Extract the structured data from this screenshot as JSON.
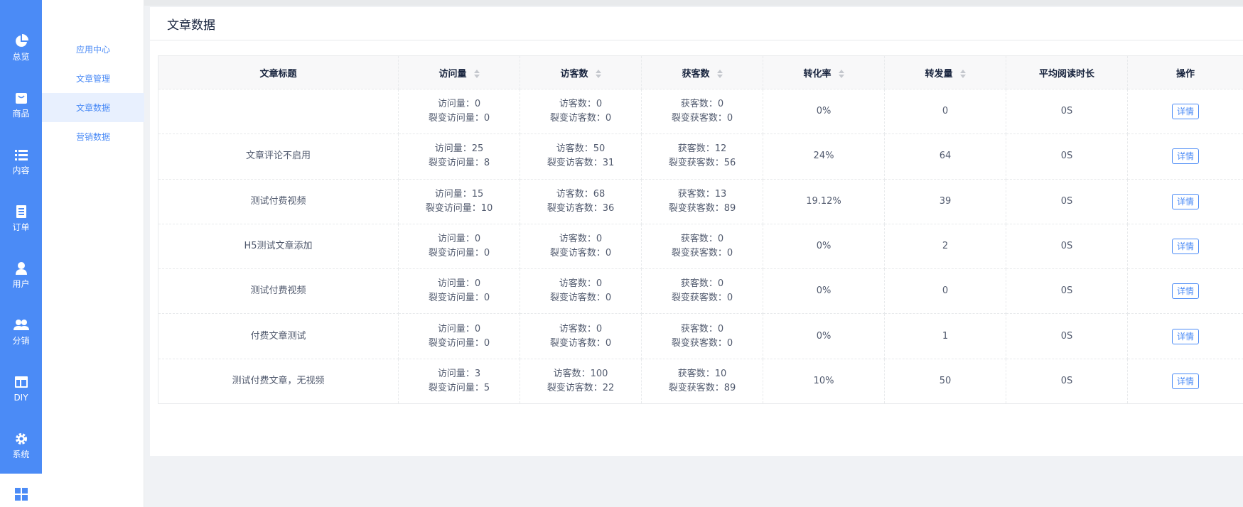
{
  "rail": {
    "items": [
      {
        "label": "总览",
        "icon": "pie-chart-icon"
      },
      {
        "label": "商品",
        "icon": "shopping-bag-icon"
      },
      {
        "label": "内容",
        "icon": "list-icon"
      },
      {
        "label": "订单",
        "icon": "document-icon"
      },
      {
        "label": "用户",
        "icon": "user-icon"
      },
      {
        "label": "分销",
        "icon": "users-icon"
      },
      {
        "label": "DIY",
        "icon": "layout-icon"
      },
      {
        "label": "系统",
        "icon": "gear-icon"
      },
      {
        "label": "",
        "icon": "apps-grid-icon"
      }
    ]
  },
  "submenu": {
    "items": [
      {
        "label": "应用中心"
      },
      {
        "label": "文章管理"
      },
      {
        "label": "文章数据",
        "active": true
      },
      {
        "label": "营销数据"
      }
    ]
  },
  "card": {
    "title": "文章数据"
  },
  "table": {
    "headers": [
      "文章标题",
      "访问量",
      "访客数",
      "获客数",
      "转化率",
      "转发量",
      "平均阅读时长",
      "操作"
    ],
    "detail_label": "详情",
    "rows": [
      {
        "title": "",
        "visits": "访问量：0",
        "fission_visits": "裂变访问量：0",
        "visitors": "访客数：0",
        "fission_visitors": "裂变访客数：0",
        "customers": "获客数：0",
        "fission_customers": "裂变获客数：0",
        "conversion": "0%",
        "shares": "0",
        "avg_read": "0S"
      },
      {
        "title": "文章评论不启用",
        "visits": "访问量：25",
        "fission_visits": "裂变访问量：8",
        "visitors": "访客数：50",
        "fission_visitors": "裂变访客数：31",
        "customers": "获客数：12",
        "fission_customers": "裂变获客数：56",
        "conversion": "24%",
        "shares": "64",
        "avg_read": "0S"
      },
      {
        "title": "测试付费视频",
        "visits": "访问量：15",
        "fission_visits": "裂变访问量：10",
        "visitors": "访客数：68",
        "fission_visitors": "裂变访客数：36",
        "customers": "获客数：13",
        "fission_customers": "裂变获客数：89",
        "conversion": "19.12%",
        "shares": "39",
        "avg_read": "0S"
      },
      {
        "title": "H5测试文章添加",
        "visits": "访问量：0",
        "fission_visits": "裂变访问量：0",
        "visitors": "访客数：0",
        "fission_visitors": "裂变访客数：0",
        "customers": "获客数：0",
        "fission_customers": "裂变获客数：0",
        "conversion": "0%",
        "shares": "2",
        "avg_read": "0S"
      },
      {
        "title": "测试付费视频",
        "visits": "访问量：0",
        "fission_visits": "裂变访问量：0",
        "visitors": "访客数：0",
        "fission_visitors": "裂变访客数：0",
        "customers": "获客数：0",
        "fission_customers": "裂变获客数：0",
        "conversion": "0%",
        "shares": "0",
        "avg_read": "0S"
      },
      {
        "title": "付费文章测试",
        "visits": "访问量：0",
        "fission_visits": "裂变访问量：0",
        "visitors": "访客数：0",
        "fission_visitors": "裂变访客数：0",
        "customers": "获客数：0",
        "fission_customers": "裂变获客数：0",
        "conversion": "0%",
        "shares": "1",
        "avg_read": "0S"
      },
      {
        "title": "测试付费文章，无视频",
        "visits": "访问量：3",
        "fission_visits": "裂变访问量：5",
        "visitors": "访客数：100",
        "fission_visitors": "裂变访客数：22",
        "customers": "获客数：10",
        "fission_customers": "裂变获客数：89",
        "conversion": "10%",
        "shares": "50",
        "avg_read": "0S"
      }
    ]
  },
  "colors": {
    "brand": "#4b8bf6",
    "active_menu_bg": "#e8f0fe",
    "page_bg": "#f0f2f5"
  }
}
